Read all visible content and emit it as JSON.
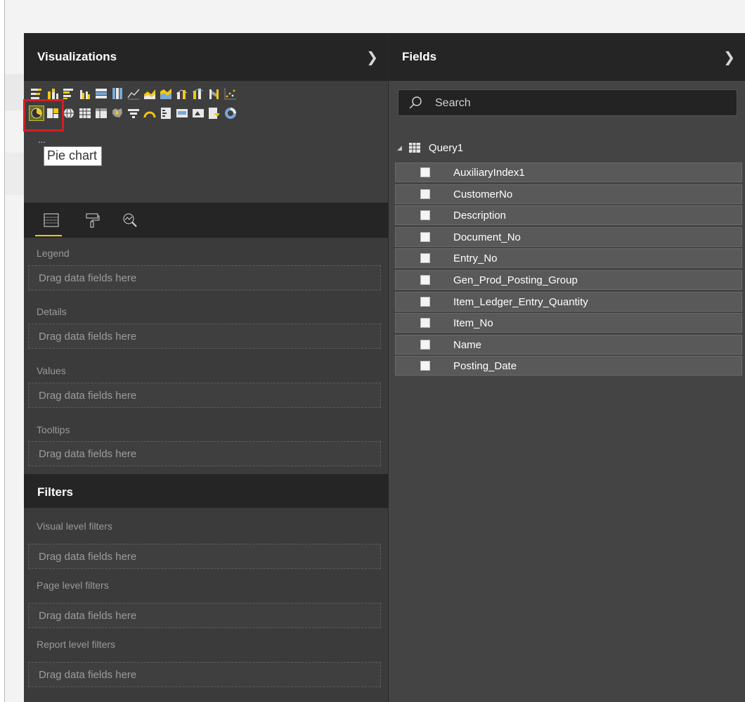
{
  "visualizations": {
    "title": "Visualizations",
    "collapse_icon": "chevron-right-icon",
    "gallery_row1": [
      "stacked-bar-icon",
      "stacked-column-icon",
      "clustered-bar-icon",
      "clustered-column-icon",
      "100-stacked-bar-icon",
      "100-stacked-column-icon",
      "line-chart-icon",
      "area-chart-icon",
      "stacked-area-icon",
      "line-column-icon",
      "line-stacked-column-icon",
      "ribbon-chart-icon",
      "scatter-chart-icon"
    ],
    "gallery_row2": [
      "pie-chart-icon",
      "treemap-icon",
      "map-icon",
      "table-icon",
      "matrix-icon",
      "filled-map-icon",
      "funnel-icon",
      "gauge-icon",
      "multi-row-card-icon",
      "card-icon",
      "kpi-icon",
      "slicer-icon",
      "donut-chart-icon"
    ],
    "selected_visual": "pie-chart-icon",
    "more_label": "...",
    "tooltip": "Pie chart",
    "tabs": [
      "fields-tab-icon",
      "format-paintbrush-icon",
      "analytics-magnifier-icon"
    ],
    "wells": [
      {
        "label": "Legend",
        "placeholder": "Drag data fields here"
      },
      {
        "label": "Details",
        "placeholder": "Drag data fields here"
      },
      {
        "label": "Values",
        "placeholder": "Drag data fields here"
      },
      {
        "label": "Tooltips",
        "placeholder": "Drag data fields here"
      }
    ]
  },
  "filters": {
    "title": "Filters",
    "wells": [
      {
        "label": "Visual level filters",
        "placeholder": "Drag data fields here"
      },
      {
        "label": "Page level filters",
        "placeholder": "Drag data fields here"
      },
      {
        "label": "Report level filters",
        "placeholder": "Drag data fields here"
      }
    ]
  },
  "fields": {
    "title": "Fields",
    "collapse_icon": "chevron-right-icon",
    "search_placeholder": "Search",
    "table_name": "Query1",
    "items": [
      "AuxiliaryIndex1",
      "CustomerNo",
      "Description",
      "Document_No",
      "Entry_No",
      "Gen_Prod_Posting_Group",
      "Item_Ledger_Entry_Quantity",
      "Item_No",
      "Name",
      "Posting_Date"
    ]
  },
  "colors": {
    "accent": "#f2c811",
    "highlight_box": "#d31f26",
    "pane_header": "#252525",
    "pane_bg": "#3b3b3b"
  }
}
